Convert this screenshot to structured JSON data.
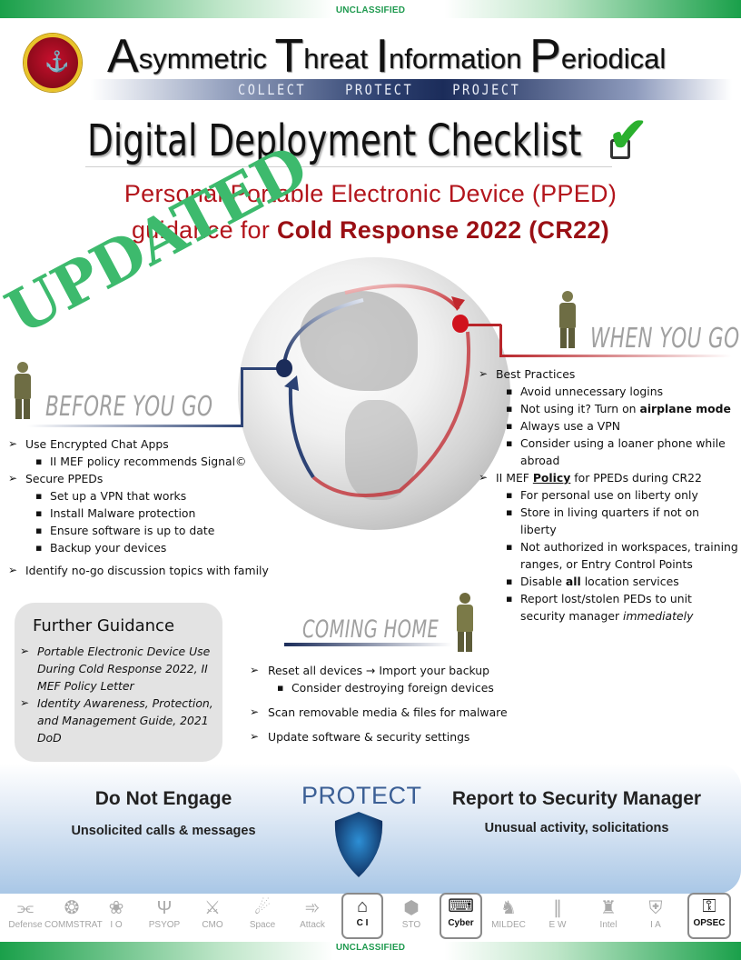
{
  "classification": {
    "top": "UNCLASSIFIED",
    "bottom": "UNCLASSIFIED",
    "color": "#1f9a4f"
  },
  "header": {
    "seal_icon": "marine-expeditionary-force-seal-icon",
    "publication": [
      {
        "cap": "A",
        "rest": "symmetric"
      },
      {
        "cap": "T",
        "rest": "hreat"
      },
      {
        "cap": "I",
        "rest": "nformation"
      },
      {
        "cap": "P",
        "rest": "eriodical"
      }
    ],
    "motto": "COLLECT    PROTECT    PROJECT"
  },
  "title": {
    "text": "Digital Deployment Checklist",
    "check_icon": "checkbox-checked-icon"
  },
  "subtitle": {
    "line1": "Personal Portable Electronic Device (PPED)",
    "line2_prefix": "guidance for ",
    "line2_bold": "Cold Response 2022 (CR22)",
    "color": "#b3151c"
  },
  "stamp": {
    "text": "UPDATED",
    "color": "#3dba6d"
  },
  "phases": {
    "before": {
      "label": "BEFORE YOU GO",
      "items": [
        {
          "level": 1,
          "text": "Use Encrypted Chat Apps"
        },
        {
          "level": 2,
          "text": "II MEF policy recommends Signal©"
        },
        {
          "level": 1,
          "text": "Secure PPEDs"
        },
        {
          "level": 2,
          "text": "Set up a VPN that works"
        },
        {
          "level": 2,
          "text": "Install Malware protection"
        },
        {
          "level": 2,
          "text": "Ensure software is up to date"
        },
        {
          "level": 2,
          "text": "Backup your devices"
        },
        {
          "level": 1,
          "text": "Identify no-go discussion topics with family",
          "gap": true
        }
      ]
    },
    "when": {
      "label": "WHEN YOU GO",
      "items": [
        {
          "level": 1,
          "text": "Best Practices"
        },
        {
          "level": 2,
          "text": "Avoid unnecessary logins"
        },
        {
          "level": 2,
          "text": "Not using it? Turn on ",
          "bold": "airplane mode"
        },
        {
          "level": 2,
          "text": "Always use a VPN"
        },
        {
          "level": 2,
          "text": "Consider using a loaner phone while abroad"
        },
        {
          "level": 1,
          "text": "II MEF ",
          "bold_underline": "Policy",
          "after": " for PPEDs during CR22"
        },
        {
          "level": 2,
          "text": "For personal use on liberty only"
        },
        {
          "level": 2,
          "text": "Store in living quarters if not on liberty"
        },
        {
          "level": 2,
          "text": "Not authorized in workspaces, training ranges, or Entry Control Points"
        },
        {
          "level": 2,
          "text": "Disable ",
          "bold": "all",
          "after": " location services"
        },
        {
          "level": 2,
          "text": "Report lost/stolen PEDs to unit security manager ",
          "italic": "immediately"
        }
      ]
    },
    "home": {
      "label": "COMING HOME",
      "items": [
        {
          "level": 1,
          "text": "Reset all devices → Import your backup"
        },
        {
          "level": 2,
          "text": "Consider destroying foreign devices"
        },
        {
          "level": 1,
          "text": "Scan removable media & files for malware",
          "gap": true
        },
        {
          "level": 1,
          "text": "Update software & security settings",
          "gap": true
        }
      ]
    }
  },
  "further_guidance": {
    "title": "Further Guidance",
    "items": [
      "Portable Electronic Device Use During Cold Response 2022, II MEF Policy Letter",
      "Identity Awareness, Protection, and Management Guide, 2021 DoD"
    ]
  },
  "protect_panel": {
    "left_heading": "Do Not Engage",
    "left_sub": "Unsolicited calls & messages",
    "center_word": "PROTECT",
    "center_icon": "shield-icon",
    "right_heading": "Report to Security Manager",
    "right_sub": "Unusual activity, solicitations"
  },
  "capabilities": [
    {
      "label": "Defense",
      "icon": "barbed-wire-icon",
      "glyph": "⫘",
      "active": false
    },
    {
      "label": "COMMSTRAT",
      "icon": "camera-aperture-icon",
      "glyph": "❂",
      "active": false
    },
    {
      "label": "I O",
      "icon": "brain-wreath-icon",
      "glyph": "❀",
      "active": false
    },
    {
      "label": "PSYOP",
      "icon": "psi-icon",
      "glyph": "Ψ",
      "active": false
    },
    {
      "label": "CMO",
      "icon": "handshake-icon",
      "glyph": "⚔",
      "active": false
    },
    {
      "label": "Space",
      "icon": "satellite-icon",
      "glyph": "☄",
      "active": false
    },
    {
      "label": "Attack",
      "icon": "artillery-icon",
      "glyph": "➾",
      "active": false
    },
    {
      "label": "C I",
      "icon": "spy-hat-glasses-icon",
      "glyph": "⌂",
      "active": true
    },
    {
      "label": "STO",
      "icon": "network-hands-icon",
      "glyph": "⬢",
      "active": false
    },
    {
      "label": "Cyber",
      "icon": "laptop-circuit-icon",
      "glyph": "⌨",
      "active": true
    },
    {
      "label": "MILDEC",
      "icon": "trojan-horse-icon",
      "glyph": "♞",
      "active": false
    },
    {
      "label": "E W",
      "icon": "waveform-icon",
      "glyph": "∥",
      "active": false
    },
    {
      "label": "Intel",
      "icon": "chess-rook-icon",
      "glyph": "♜",
      "active": false
    },
    {
      "label": "I A",
      "icon": "document-shield-icon",
      "glyph": "⛨",
      "active": false
    },
    {
      "label": "OPSEC",
      "icon": "padlock-open-icon",
      "glyph": "⚿",
      "active": true
    }
  ]
}
